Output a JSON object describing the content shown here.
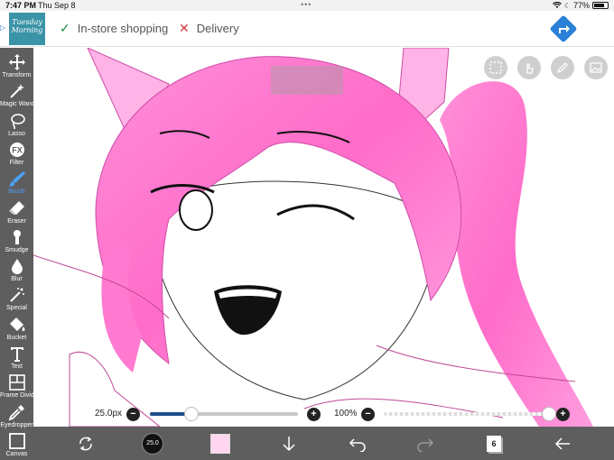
{
  "status": {
    "time": "7:47 PM",
    "date": "Thu Sep 8",
    "battery": "77%",
    "battery_level": 0.77
  },
  "ad": {
    "brand_line1": "Tuesday",
    "brand_line2": "Morning",
    "item1": "In-store shopping",
    "item2": "Delivery",
    "accent_color": "#2a80d6"
  },
  "tools": [
    {
      "name": "Transform",
      "icon": "move-icon"
    },
    {
      "name": "Magic Wand",
      "icon": "magic-wand-icon"
    },
    {
      "name": "Lasso",
      "icon": "lasso-icon"
    },
    {
      "name": "Filter",
      "icon": "fx-icon"
    },
    {
      "name": "Brush",
      "icon": "brush-icon"
    },
    {
      "name": "Eraser",
      "icon": "eraser-icon"
    },
    {
      "name": "Smudge",
      "icon": "smudge-icon"
    },
    {
      "name": "Blur",
      "icon": "blur-drop-icon"
    },
    {
      "name": "Special",
      "icon": "special-wand-icon"
    },
    {
      "name": "Bucket",
      "icon": "bucket-icon"
    },
    {
      "name": "Text",
      "icon": "text-icon"
    },
    {
      "name": "Frame Divider",
      "icon": "frame-divider-icon"
    },
    {
      "name": "Eyedropper",
      "icon": "eyedropper-icon"
    },
    {
      "name": "Canvas",
      "icon": "canvas-icon"
    }
  ],
  "active_tool": "Brush",
  "brush": {
    "size_label": "25.0px",
    "size_fraction": 0.28,
    "preview_label": "25.0"
  },
  "opacity": {
    "label": "100%",
    "fraction": 1.0
  },
  "color": {
    "current": "#ffd6ee",
    "accent": "#4aa3ff",
    "hair_pink": "#ff7ad0"
  },
  "layers": {
    "count": "6"
  }
}
